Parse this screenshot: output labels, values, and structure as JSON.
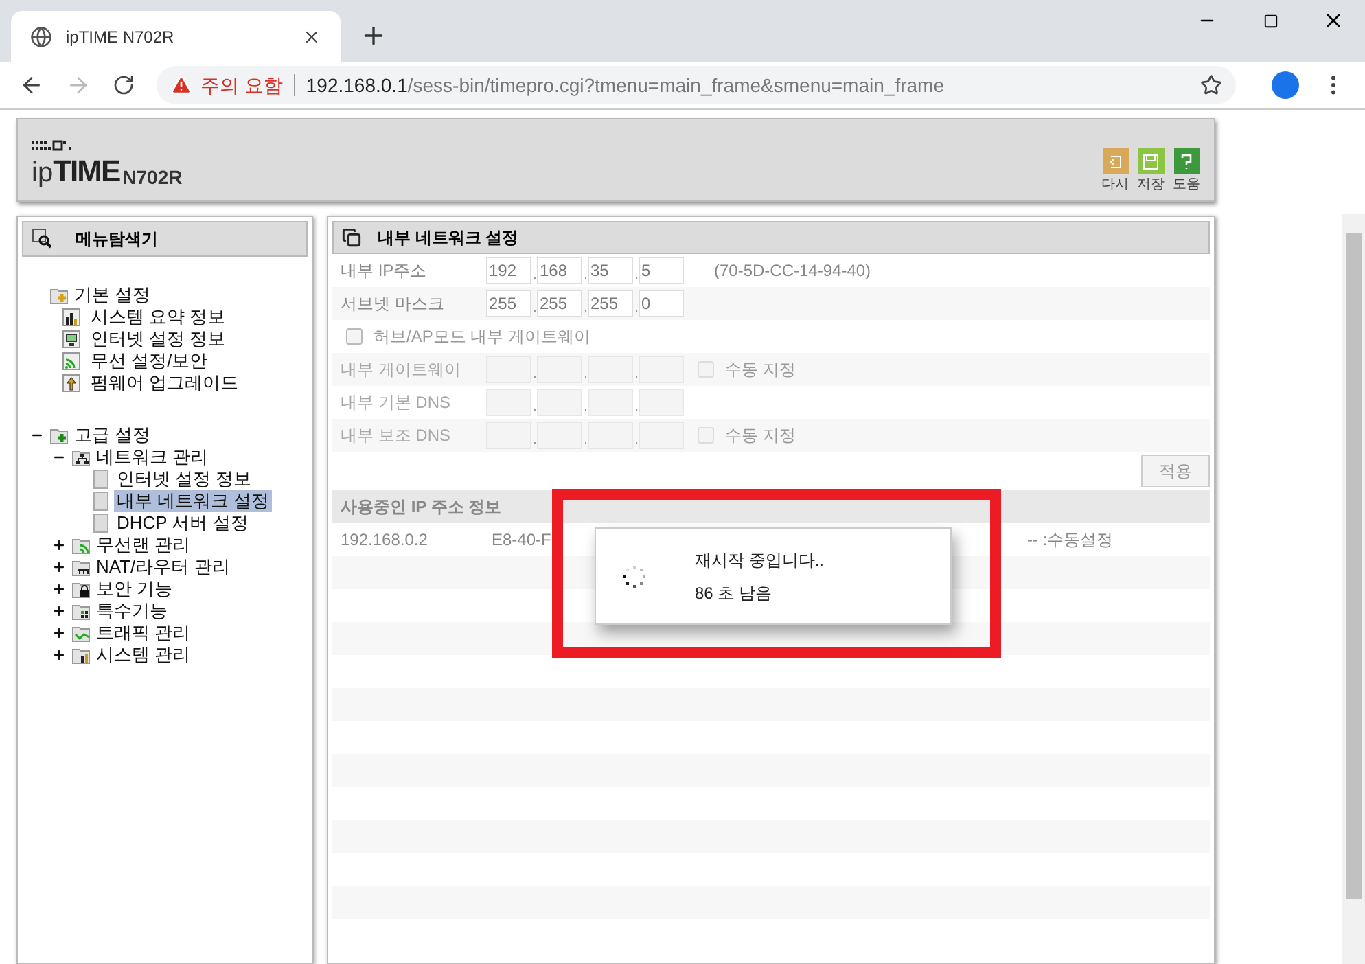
{
  "browser": {
    "tab_title": "ipTIME N702R",
    "security": "주의 요함",
    "url_host": "192.168.0.1",
    "url_path": "/sess-bin/timepro.cgi?tmenu=main_frame&smenu=main_frame"
  },
  "header": {
    "logo_prefix": "ip",
    "logo_main": "TIME",
    "model": "N702R",
    "buttons": [
      {
        "label": "다시",
        "kind": "undo"
      },
      {
        "label": "저장",
        "kind": "save"
      },
      {
        "label": "도움",
        "kind": "help"
      }
    ]
  },
  "sidebar": {
    "title": "메뉴탐색기",
    "groups": [
      {
        "label": "기본 설정",
        "kind": "basic",
        "children": [
          {
            "label": "시스템 요약 정보",
            "selected": false
          },
          {
            "label": "인터넷 설정 정보",
            "selected": false
          },
          {
            "label": "무선 설정/보안",
            "selected": false
          },
          {
            "label": "펌웨어 업그레이드",
            "selected": false
          }
        ]
      },
      {
        "label": "고급 설정",
        "kind": "advanced",
        "expanded": true,
        "children": [
          {
            "label": "네트워크 관리",
            "expanded": true,
            "children": [
              {
                "label": "인터넷 설정 정보",
                "selected": false
              },
              {
                "label": "내부 네트워크 설정",
                "selected": true
              },
              {
                "label": "DHCP 서버 설정",
                "selected": false
              }
            ]
          },
          {
            "label": "무선랜 관리",
            "expanded": false
          },
          {
            "label": "NAT/라우터 관리",
            "expanded": false
          },
          {
            "label": "보안 기능",
            "expanded": false
          },
          {
            "label": "특수기능",
            "expanded": false
          },
          {
            "label": "트래픽 관리",
            "expanded": false
          },
          {
            "label": "시스템 관리",
            "expanded": false
          }
        ]
      }
    ]
  },
  "panel": {
    "title": "내부 네트워크 설정",
    "rows": [
      {
        "kind": "ip",
        "label": "내부 IP주소",
        "disabled": false,
        "octets": [
          "192",
          "168",
          "35",
          "5"
        ],
        "note": "(70-5D-CC-14-94-40)"
      },
      {
        "kind": "ip",
        "label": "서브넷 마스크",
        "disabled": false,
        "octets": [
          "255",
          "255",
          "255",
          "0"
        ]
      },
      {
        "kind": "checkbox",
        "label": "허브/AP모드 내부 게이트웨이",
        "checked": false
      },
      {
        "kind": "ip",
        "label": "내부 게이트웨이",
        "disabled": true,
        "manual": {
          "label": "수동 지정",
          "checked": false
        }
      },
      {
        "kind": "ip",
        "label": "내부 기본 DNS",
        "disabled": true
      },
      {
        "kind": "ip",
        "label": "내부 보조 DNS",
        "disabled": true,
        "manual": {
          "label": "수동 지정",
          "checked": false
        }
      }
    ],
    "apply": "적용"
  },
  "ip_table": {
    "title": "사용중인 IP 주소 정보",
    "rows": [
      {
        "ip": "192.168.0.2",
        "mac": "E8-40-F",
        "type": "-- :수동설정"
      }
    ]
  },
  "dialog": {
    "message": "재시작 중입니다..",
    "remaining": "86 초 남음"
  }
}
